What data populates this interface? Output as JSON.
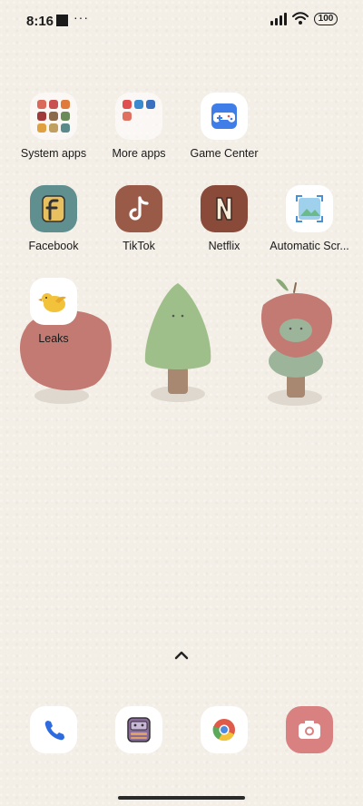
{
  "status_bar": {
    "time": "8:16",
    "dots": "···",
    "battery": "100"
  },
  "apps": [
    {
      "label": "System apps",
      "icon": "folder-icon"
    },
    {
      "label": "More apps",
      "icon": "folder-icon"
    },
    {
      "label": "Game Center",
      "icon": "gamepad-icon"
    },
    {
      "label": "Facebook",
      "icon": "facebook-icon"
    },
    {
      "label": "TikTok",
      "icon": "tiktok-icon"
    },
    {
      "label": "Netflix",
      "icon": "netflix-icon"
    },
    {
      "label": "Automatic Scr...",
      "icon": "screenshot-icon"
    },
    {
      "label": "Leaks",
      "icon": "bird-icon"
    }
  ],
  "dock": [
    {
      "icon": "phone-icon"
    },
    {
      "icon": "messages-icon"
    },
    {
      "icon": "chrome-icon"
    },
    {
      "icon": "camera-icon"
    }
  ],
  "colors": {
    "background": "#f3eee6",
    "facebook_tile": "#5f8f8f",
    "tiktok_tile": "#9a5a48",
    "netflix_tile": "#8a4a3a",
    "camera_tile": "#d98080"
  }
}
